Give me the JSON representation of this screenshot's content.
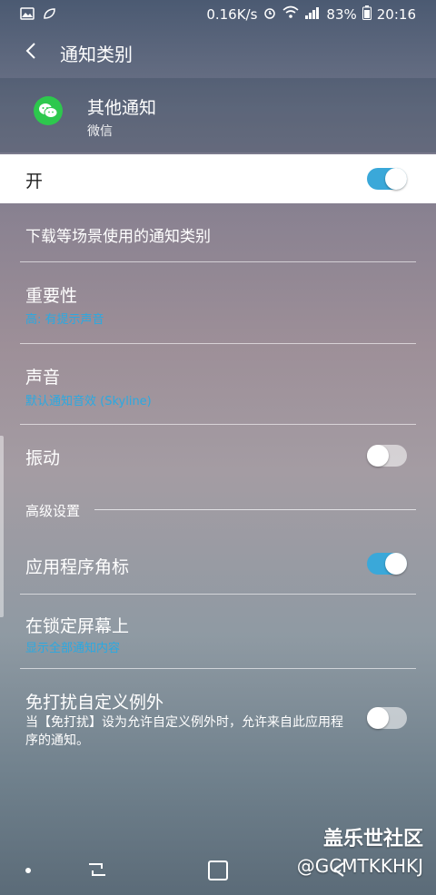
{
  "status_bar": {
    "speed": "0.16K/s",
    "battery": "83%",
    "time": "20:16"
  },
  "title_bar": {
    "title": "通知类别"
  },
  "app_header": {
    "name": "其他通知",
    "app": "微信",
    "icon": "wechat-icon",
    "icon_color": "#2dc84d"
  },
  "master_switch": {
    "label": "开",
    "on": true
  },
  "rows": {
    "description": "下载等场景使用的通知类别",
    "importance": {
      "label": "重要性",
      "value": "高: 有提示声音"
    },
    "sound": {
      "label": "声音",
      "value": "默认通知音效 (Skyline)"
    },
    "vibration": {
      "label": "振动",
      "on": false
    }
  },
  "advanced": {
    "section_label": "高级设置",
    "app_badge": {
      "label": "应用程序角标",
      "on": true
    },
    "lock_screen": {
      "label": "在锁定屏幕上",
      "value": "显示全部通知内容"
    },
    "dnd": {
      "label": "免打扰自定义例外",
      "desc": "当【免打扰】设为允许自定义例外时，允许来自此应用程序的通知。",
      "on": false
    }
  },
  "watermark": {
    "brand": "盖乐世社区",
    "handle": "@GCMTKKHKJ"
  },
  "colors": {
    "accent": "#3aa8d9",
    "link": "#2aa9e2"
  }
}
